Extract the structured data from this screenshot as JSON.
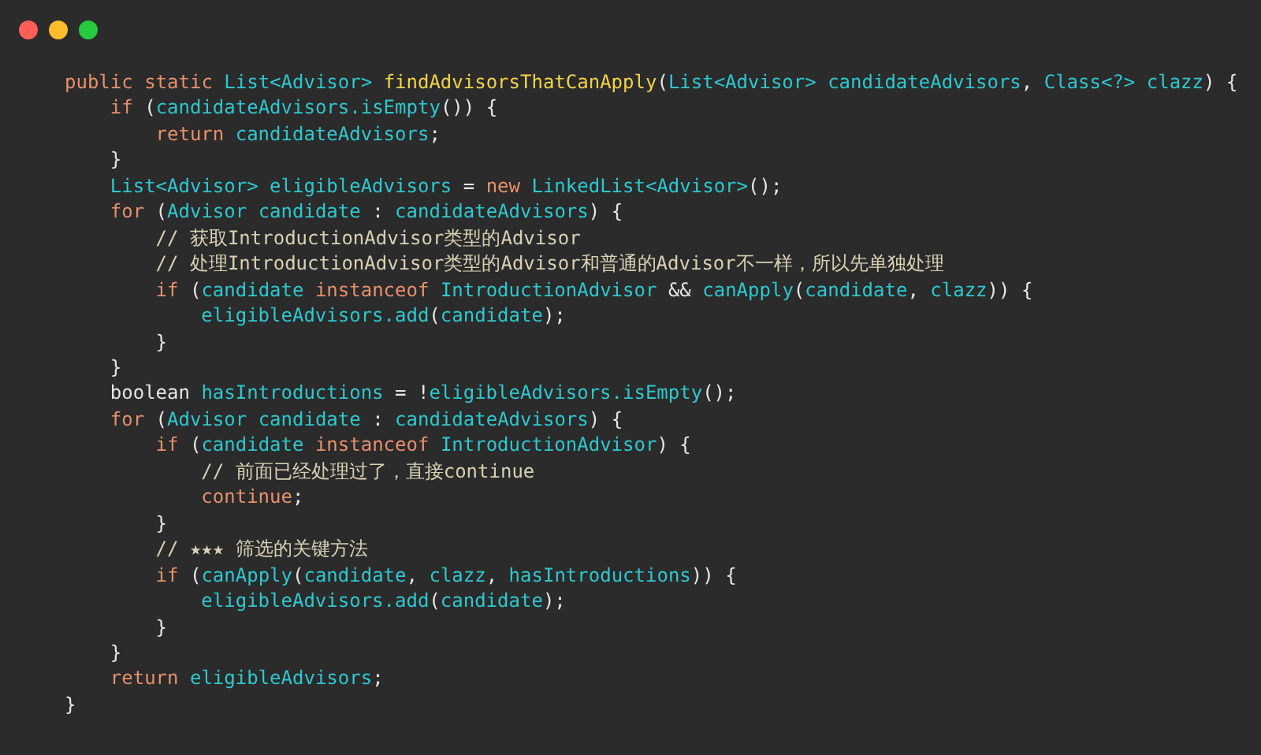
{
  "window": {
    "controls": [
      {
        "kind": "close"
      },
      {
        "kind": "minimize"
      },
      {
        "kind": "zoom"
      }
    ]
  },
  "code_lines": [
    {
      "tokens": [
        {
          "text": "public static ",
          "kind": "keyword"
        },
        {
          "text": "List<Advisor> ",
          "kind": "ident"
        },
        {
          "text": "findAdvisorsThatCanApply",
          "kind": "function"
        },
        {
          "text": "(",
          "kind": "plain"
        },
        {
          "text": "List<Advisor> candidateAdvisors",
          "kind": "ident"
        },
        {
          "text": ", ",
          "kind": "plain"
        },
        {
          "text": "Class<?> clazz",
          "kind": "ident"
        },
        {
          "text": ") {",
          "kind": "plain"
        }
      ],
      "children": [
        {
          "tokens": [
            {
              "text": "if ",
              "kind": "keyword"
            },
            {
              "text": "(",
              "kind": "plain"
            },
            {
              "text": "candidateAdvisors.isEmpty",
              "kind": "ident"
            },
            {
              "text": "()) {",
              "kind": "plain"
            }
          ],
          "children": [
            {
              "tokens": [
                {
                  "text": "return ",
                  "kind": "keyword"
                },
                {
                  "text": "candidateAdvisors",
                  "kind": "ident"
                },
                {
                  "text": ";",
                  "kind": "plain"
                }
              ]
            }
          ]
        },
        {
          "tokens": [
            {
              "text": "}",
              "kind": "plain"
            }
          ]
        },
        {
          "tokens": [
            {
              "text": "List<Advisor> eligibleAdvisors",
              "kind": "ident"
            },
            {
              "text": " = ",
              "kind": "plain"
            },
            {
              "text": "new ",
              "kind": "keyword"
            },
            {
              "text": "LinkedList<Advisor>",
              "kind": "ident"
            },
            {
              "text": "();",
              "kind": "plain"
            }
          ]
        },
        {
          "tokens": [
            {
              "text": "for ",
              "kind": "keyword"
            },
            {
              "text": "(",
              "kind": "plain"
            },
            {
              "text": "Advisor candidate",
              "kind": "ident"
            },
            {
              "text": " : ",
              "kind": "plain"
            },
            {
              "text": "candidateAdvisors",
              "kind": "ident"
            },
            {
              "text": ") {",
              "kind": "plain"
            }
          ],
          "children": [
            {
              "tokens": [
                {
                  "text": "// 获取IntroductionAdvisor类型的Advisor",
                  "kind": "comment"
                }
              ]
            },
            {
              "tokens": [
                {
                  "text": "// 处理IntroductionAdvisor类型的Advisor和普通的Advisor不一样，所以先单独处理",
                  "kind": "comment"
                }
              ]
            },
            {
              "tokens": [
                {
                  "text": "if ",
                  "kind": "keyword"
                },
                {
                  "text": "(",
                  "kind": "plain"
                },
                {
                  "text": "candidate",
                  "kind": "ident"
                },
                {
                  "text": " instanceof ",
                  "kind": "keyword"
                },
                {
                  "text": "IntroductionAdvisor",
                  "kind": "ident"
                },
                {
                  "text": " && ",
                  "kind": "plain"
                },
                {
                  "text": "canApply",
                  "kind": "ident"
                },
                {
                  "text": "(",
                  "kind": "plain"
                },
                {
                  "text": "candidate",
                  "kind": "ident"
                },
                {
                  "text": ", ",
                  "kind": "plain"
                },
                {
                  "text": "clazz",
                  "kind": "ident"
                },
                {
                  "text": ")) {",
                  "kind": "plain"
                }
              ],
              "children": [
                {
                  "tokens": [
                    {
                      "text": "eligibleAdvisors.add",
                      "kind": "ident"
                    },
                    {
                      "text": "(",
                      "kind": "plain"
                    },
                    {
                      "text": "candidate",
                      "kind": "ident"
                    },
                    {
                      "text": ");",
                      "kind": "plain"
                    }
                  ]
                }
              ]
            },
            {
              "tokens": [
                {
                  "text": "}",
                  "kind": "plain"
                }
              ]
            }
          ]
        },
        {
          "tokens": [
            {
              "text": "}",
              "kind": "plain"
            }
          ]
        },
        {
          "tokens": [
            {
              "text": "boolean ",
              "kind": "plain"
            },
            {
              "text": "hasIntroductions",
              "kind": "ident"
            },
            {
              "text": " = !",
              "kind": "plain"
            },
            {
              "text": "eligibleAdvisors.isEmpty",
              "kind": "ident"
            },
            {
              "text": "();",
              "kind": "plain"
            }
          ]
        },
        {
          "tokens": [
            {
              "text": "for ",
              "kind": "keyword"
            },
            {
              "text": "(",
              "kind": "plain"
            },
            {
              "text": "Advisor candidate",
              "kind": "ident"
            },
            {
              "text": " : ",
              "kind": "plain"
            },
            {
              "text": "candidateAdvisors",
              "kind": "ident"
            },
            {
              "text": ") {",
              "kind": "plain"
            }
          ],
          "children": [
            {
              "tokens": [
                {
                  "text": "if ",
                  "kind": "keyword"
                },
                {
                  "text": "(",
                  "kind": "plain"
                },
                {
                  "text": "candidate",
                  "kind": "ident"
                },
                {
                  "text": " instanceof ",
                  "kind": "keyword"
                },
                {
                  "text": "IntroductionAdvisor",
                  "kind": "ident"
                },
                {
                  "text": ") {",
                  "kind": "plain"
                }
              ],
              "children": [
                {
                  "tokens": [
                    {
                      "text": "// 前面已经处理过了，直接continue",
                      "kind": "comment"
                    }
                  ]
                },
                {
                  "tokens": [
                    {
                      "text": "continue",
                      "kind": "keyword"
                    },
                    {
                      "text": ";",
                      "kind": "plain"
                    }
                  ]
                }
              ]
            },
            {
              "tokens": [
                {
                  "text": "}",
                  "kind": "plain"
                }
              ]
            },
            {
              "tokens": [
                {
                  "text": "// ★★★ 筛选的关键方法",
                  "kind": "comment"
                }
              ]
            },
            {
              "tokens": [
                {
                  "text": "if ",
                  "kind": "keyword"
                },
                {
                  "text": "(",
                  "kind": "plain"
                },
                {
                  "text": "canApply",
                  "kind": "ident"
                },
                {
                  "text": "(",
                  "kind": "plain"
                },
                {
                  "text": "candidate",
                  "kind": "ident"
                },
                {
                  "text": ", ",
                  "kind": "plain"
                },
                {
                  "text": "clazz",
                  "kind": "ident"
                },
                {
                  "text": ", ",
                  "kind": "plain"
                },
                {
                  "text": "hasIntroductions",
                  "kind": "ident"
                },
                {
                  "text": ")) {",
                  "kind": "plain"
                }
              ],
              "children": [
                {
                  "tokens": [
                    {
                      "text": "eligibleAdvisors.add",
                      "kind": "ident"
                    },
                    {
                      "text": "(",
                      "kind": "plain"
                    },
                    {
                      "text": "candidate",
                      "kind": "ident"
                    },
                    {
                      "text": ");",
                      "kind": "plain"
                    }
                  ]
                }
              ]
            },
            {
              "tokens": [
                {
                  "text": "}",
                  "kind": "plain"
                }
              ]
            }
          ]
        },
        {
          "tokens": [
            {
              "text": "}",
              "kind": "plain"
            }
          ]
        },
        {
          "tokens": [
            {
              "text": "return ",
              "kind": "keyword"
            },
            {
              "text": "eligibleAdvisors",
              "kind": "ident"
            },
            {
              "text": ";",
              "kind": "plain"
            }
          ]
        }
      ]
    },
    {
      "tokens": [
        {
          "text": "}",
          "kind": "plain"
        }
      ]
    }
  ]
}
